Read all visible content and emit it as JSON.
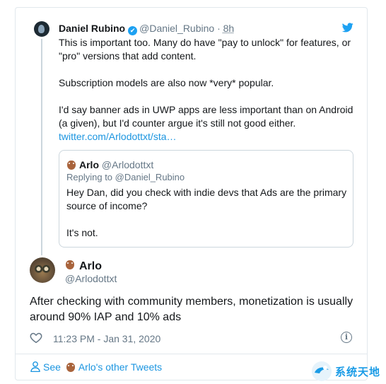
{
  "parent_tweet": {
    "author_name": "Daniel Rubino",
    "verified_glyph": "✔",
    "handle": "@Daniel_Rubino",
    "separator": "·",
    "time": "8h",
    "paragraphs": [
      "This is important too. Many do have \"pay to unlock\" for features, or \"pro\" versions that add content.",
      "Subscription models are also now *very* popular.",
      "I'd say banner ads in UWP apps are less important than on Android (a given), but I'd counter argue it's still not good either."
    ],
    "link": "twitter.com/Arlodottxt/sta…"
  },
  "quoted_tweet": {
    "author_name": "Arlo",
    "handle": "@Arlodottxt",
    "replying_to": "Replying to @Daniel_Rubino",
    "paragraphs": [
      "Hey Dan, did you check with indie devs that Ads are the primary source of income?",
      "It's not."
    ]
  },
  "main_tweet": {
    "author_name": "Arlo",
    "handle": "@Arlodottxt",
    "text": "After checking with community members, monetization is usually around 90% IAP and 10% ads",
    "timestamp": "11:23 PM - Jan 31, 2020",
    "info_glyph": "i"
  },
  "footer": {
    "see_label": "See",
    "other_tweets_label": "Arlo's other Tweets"
  },
  "watermark": {
    "text": "系统天地"
  },
  "colors": {
    "twitter_blue": "#1da1f2",
    "link_blue": "#1b95e0",
    "muted_gray": "#657786",
    "border": "#e1e8ed"
  },
  "icons": [
    "twitter-bird-icon",
    "verified-icon",
    "owl-emoji-icon",
    "heart-icon",
    "info-icon",
    "person-icon"
  ]
}
